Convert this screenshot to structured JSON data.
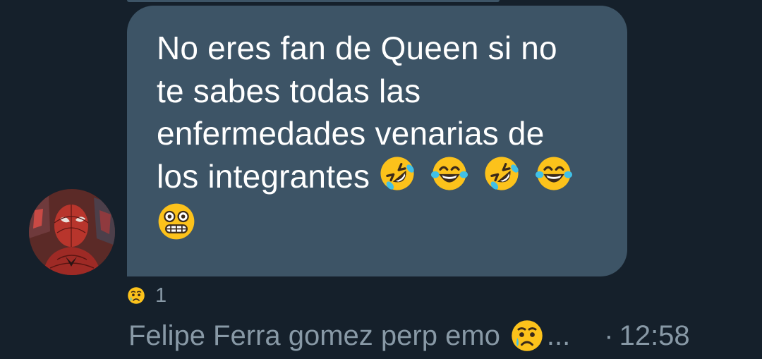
{
  "message": {
    "lines": [
      "No eres fan de Queen si no",
      "te sabes todas las",
      "enfermedades venarias de",
      "los integrantes"
    ],
    "emojis": [
      "rolling-on-floor-laughing",
      "tears-of-joy",
      "rolling-on-floor-laughing",
      "tears-of-joy",
      "grimacing-flushed"
    ]
  },
  "reaction": {
    "emoji": "crying-face",
    "count": "1"
  },
  "footer": {
    "sender": "Felipe Ferra gomez perp emo",
    "sender_emoji": "crying-face",
    "ellipsis": "...",
    "separator": "·",
    "time": "12:58"
  },
  "colors": {
    "background": "#15202b",
    "bubble": "#3d5466",
    "text": "#ffffff",
    "muted": "#8899a6",
    "emoji_yellow": "#fcc21b"
  }
}
